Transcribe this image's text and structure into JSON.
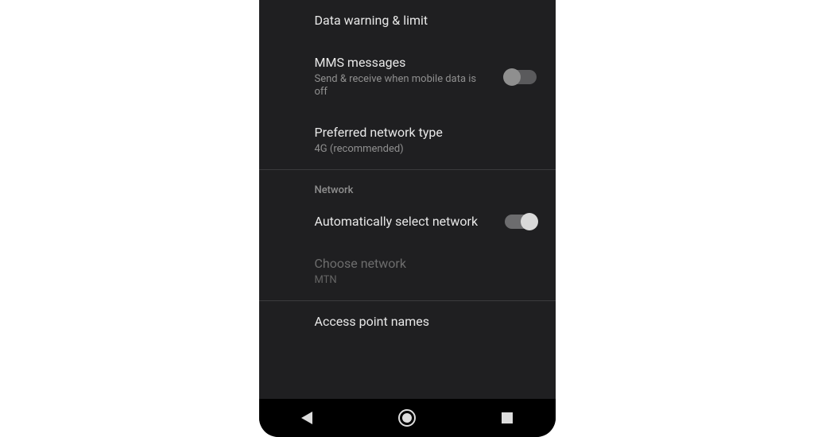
{
  "items": {
    "data_warning_limit": {
      "title": "Data warning & limit"
    },
    "mms": {
      "title": "MMS messages",
      "sub": "Send & receive when mobile data is off",
      "toggle": false
    },
    "preferred_network_type": {
      "title": "Preferred network type",
      "sub": "4G (recommended)"
    }
  },
  "section_network_header": "Network",
  "network": {
    "auto_select": {
      "title": "Automatically select network",
      "toggle": true
    },
    "choose": {
      "title": "Choose network",
      "sub": "MTN"
    },
    "apn": {
      "title": "Access point names"
    }
  }
}
